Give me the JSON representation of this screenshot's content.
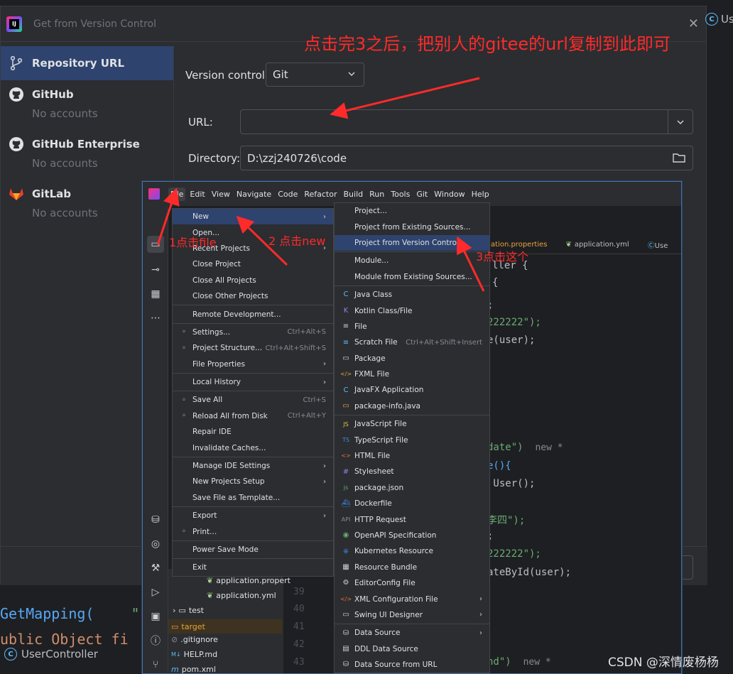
{
  "dialog": {
    "title": "Get from Version Control",
    "sidebar": [
      {
        "label": "Repository URL",
        "sub": ""
      },
      {
        "label": "GitHub",
        "sub": "No accounts"
      },
      {
        "label": "GitHub Enterprise",
        "sub": "No accounts"
      },
      {
        "label": "GitLab",
        "sub": "No accounts"
      }
    ],
    "version_control_label": "Version control:",
    "version_control_value": "Git",
    "url_label": "URL:",
    "url_value": "",
    "directory_label": "Directory:",
    "directory_value": "D:\\zzj240726\\code"
  },
  "annotations": {
    "top": "点击完3之后，把别人的gitee的url复制到此即可",
    "step1": "1点击file",
    "step2": "2 点击new",
    "step3": "3点击这个"
  },
  "right_tab_partial": "Us",
  "background": {
    "code_line1_a": "GetMapping(",
    "code_line1_b": "\"",
    "code_line2": "ublic Object fi",
    "tab_label": "UserController"
  },
  "ide": {
    "menubar": [
      "File",
      "Edit",
      "View",
      "Navigate",
      "Code",
      "Refactor",
      "Build",
      "Run",
      "Tools",
      "Git",
      "Window",
      "Help"
    ],
    "project_badge": "D",
    "editor_tabs": [
      "ation.properties",
      "application.yml",
      "Use"
    ],
    "code": [
      {
        "text": "ller {"
      },
      {
        "text": "{"
      },
      {
        "text": ";"
      },
      {
        "text": "222222\");"
      },
      {
        "text": "e(user);"
      },
      {
        "text": "date\")",
        "note": "new *"
      },
      {
        "text": "e(){"
      },
      {
        "text": " User();"
      },
      {
        "text": "李四\");"
      },
      {
        "text": ";"
      },
      {
        "text": "222222\");"
      },
      {
        "text": "ateById(user);"
      },
      {
        "text": "nd\")",
        "note": "new *"
      }
    ],
    "line_numbers": [
      "39",
      "40",
      "41",
      "42",
      "43"
    ],
    "tree": [
      {
        "label": "application.propert"
      },
      {
        "label": "application.yml"
      },
      {
        "label": "test"
      },
      {
        "label": "target"
      },
      {
        "label": ".gitignore"
      },
      {
        "label": "HELP.md"
      },
      {
        "label": "pom.xml"
      }
    ]
  },
  "file_menu": [
    {
      "label": "New",
      "shortcut": "",
      "arrow": true,
      "active": true
    },
    {
      "label": "Open...",
      "shortcut": "",
      "arrow": false
    },
    {
      "label": "Recent Projects",
      "shortcut": "",
      "arrow": true
    },
    {
      "label": "Close Project",
      "shortcut": "",
      "arrow": false
    },
    {
      "label": "Close All Projects",
      "shortcut": "",
      "arrow": false
    },
    {
      "label": "Close Other Projects",
      "shortcut": "",
      "arrow": false,
      "sep_after": true
    },
    {
      "label": "Remote Development...",
      "shortcut": "",
      "arrow": false,
      "sep_after": true
    },
    {
      "label": "Settings...",
      "shortcut": "Ctrl+Alt+S",
      "arrow": false,
      "icon": "gear-icon"
    },
    {
      "label": "Project Structure...",
      "shortcut": "Ctrl+Alt+Shift+S",
      "arrow": false,
      "icon": "folder-grid-icon"
    },
    {
      "label": "File Properties",
      "shortcut": "",
      "arrow": true,
      "sep_after": true
    },
    {
      "label": "Local History",
      "shortcut": "",
      "arrow": true,
      "sep_after": true
    },
    {
      "label": "Save All",
      "shortcut": "Ctrl+S",
      "arrow": false,
      "icon": "save-icon"
    },
    {
      "label": "Reload All from Disk",
      "shortcut": "Ctrl+Alt+Y",
      "arrow": false,
      "icon": "reload-icon"
    },
    {
      "label": "Repair IDE",
      "shortcut": "",
      "arrow": false
    },
    {
      "label": "Invalidate Caches...",
      "shortcut": "",
      "arrow": false,
      "sep_after": true
    },
    {
      "label": "Manage IDE Settings",
      "shortcut": "",
      "arrow": true
    },
    {
      "label": "New Projects Setup",
      "shortcut": "",
      "arrow": true
    },
    {
      "label": "Save File as Template...",
      "shortcut": "",
      "arrow": false,
      "sep_after": true
    },
    {
      "label": "Export",
      "shortcut": "",
      "arrow": true
    },
    {
      "label": "Print...",
      "shortcut": "",
      "arrow": false,
      "icon": "printer-icon",
      "sep_after": true
    },
    {
      "label": "Power Save Mode",
      "shortcut": "",
      "arrow": false,
      "sep_after": true
    },
    {
      "label": "Exit",
      "shortcut": "",
      "arrow": false
    }
  ],
  "new_menu_top": [
    {
      "label": "Project...",
      "active": false
    },
    {
      "label": "Project from Existing Sources...",
      "active": false
    },
    {
      "label": "Project from Version Control...",
      "active": true
    },
    {
      "label": "Module...",
      "active": false
    },
    {
      "label": "Module from Existing Sources...",
      "active": false
    }
  ],
  "new_menu": [
    {
      "label": "Java Class",
      "icon": "java-class-icon",
      "color": "#5fb8f5",
      "glyph": "C"
    },
    {
      "label": "Kotlin Class/File",
      "icon": "kotlin-icon",
      "color": "#9f7aea",
      "glyph": "K"
    },
    {
      "label": "File",
      "icon": "file-icon",
      "color": "#ced0d6",
      "glyph": "≡"
    },
    {
      "label": "Scratch File",
      "shortcut": "Ctrl+Alt+Shift+Insert",
      "icon": "scratch-file-icon",
      "color": "#5fb8f5",
      "glyph": "≡"
    },
    {
      "label": "Package",
      "icon": "package-icon",
      "color": "#ced0d6",
      "glyph": "▭"
    },
    {
      "label": "FXML File",
      "icon": "fxml-icon",
      "color": "#e8a33d",
      "glyph": "</>"
    },
    {
      "label": "JavaFX Application",
      "icon": "javafx-icon",
      "color": "#5fb8f5",
      "glyph": "C"
    },
    {
      "label": "package-info.java",
      "icon": "package-info-icon",
      "color": "#e8a33d",
      "glyph": "▭",
      "sep_after": true
    },
    {
      "label": "JavaScript File",
      "icon": "javascript-icon",
      "color": "#e8c43d",
      "glyph": "JS"
    },
    {
      "label": "TypeScript File",
      "icon": "typescript-icon",
      "color": "#3d8be8",
      "glyph": "TS"
    },
    {
      "label": "HTML File",
      "icon": "html-icon",
      "color": "#e8703d",
      "glyph": "<>"
    },
    {
      "label": "Stylesheet",
      "icon": "css-icon",
      "color": "#9f7aea",
      "glyph": "#"
    },
    {
      "label": "package.json",
      "icon": "package-json-icon",
      "color": "#6aab73",
      "glyph": "js"
    },
    {
      "label": "Dockerfile",
      "icon": "docker-icon",
      "color": "#3d8be8",
      "glyph": "⛴"
    },
    {
      "label": "HTTP Request",
      "icon": "http-request-icon",
      "color": "#868a91",
      "glyph": "API"
    },
    {
      "label": "OpenAPI Specification",
      "icon": "openapi-icon",
      "color": "#6aab73",
      "glyph": "◉"
    },
    {
      "label": "Kubernetes Resource",
      "icon": "kubernetes-icon",
      "color": "#3d8be8",
      "glyph": "⎈"
    },
    {
      "label": "Resource Bundle",
      "icon": "resource-bundle-icon",
      "color": "#ced0d6",
      "glyph": "▦"
    },
    {
      "label": "EditorConfig File",
      "icon": "editorconfig-icon",
      "color": "#ced0d6",
      "glyph": "⚙"
    },
    {
      "label": "XML Configuration File",
      "icon": "xml-icon",
      "color": "#e8703d",
      "glyph": "</>",
      "arrow": true
    },
    {
      "label": "Swing UI Designer",
      "icon": "swing-icon",
      "color": "#ced0d6",
      "glyph": "▭",
      "arrow": true,
      "sep_after": true
    },
    {
      "label": "Data Source",
      "icon": "database-icon",
      "color": "#ced0d6",
      "glyph": "⛁",
      "arrow": true
    },
    {
      "label": "DDL Data Source",
      "icon": "ddl-icon",
      "color": "#ced0d6",
      "glyph": "▤"
    },
    {
      "label": "Data Source from URL",
      "icon": "url-datasource-icon",
      "color": "#ced0d6",
      "glyph": "⛁"
    }
  ],
  "watermark": "CSDN @深情废杨杨",
  "colors": {
    "accent": "#2e436e",
    "annotation": "#ff2a2a",
    "background": "#1e1f22",
    "panel": "#2b2d30"
  }
}
